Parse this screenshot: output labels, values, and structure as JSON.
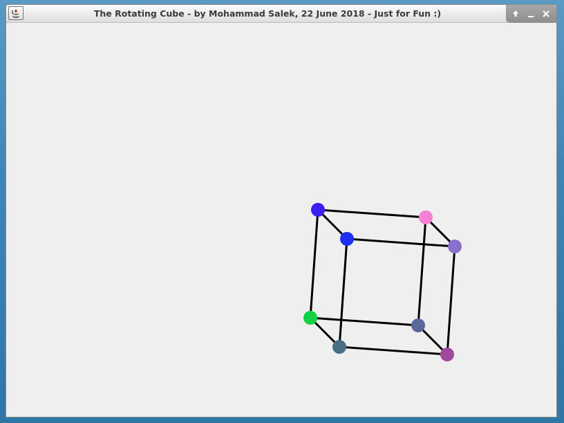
{
  "window": {
    "title": "The Rotating Cube - by Mohammad Salek, 22 June 2018 - Just for Fun :)",
    "icon": "java-app-icon",
    "controls": {
      "maximize": "maximize-icon",
      "minimize": "minimize-icon",
      "close": "close-icon"
    }
  },
  "scene": {
    "edge_color": "#000000",
    "vertices": [
      {
        "id": "v1",
        "color": "#3a1ff0"
      },
      {
        "id": "v2",
        "color": "#f47fd4"
      },
      {
        "id": "v3",
        "color": "#1f2ef3"
      },
      {
        "id": "v4",
        "color": "#8b6fcc"
      },
      {
        "id": "v5",
        "color": "#10d243"
      },
      {
        "id": "v6",
        "color": "#59689b"
      },
      {
        "id": "v7",
        "color": "#476e83"
      },
      {
        "id": "v8",
        "color": "#a0479e"
      }
    ],
    "edges": [
      [
        "v1",
        "v2"
      ],
      [
        "v1",
        "v3"
      ],
      [
        "v2",
        "v4"
      ],
      [
        "v3",
        "v4"
      ],
      [
        "v5",
        "v6"
      ],
      [
        "v5",
        "v7"
      ],
      [
        "v6",
        "v8"
      ],
      [
        "v7",
        "v8"
      ],
      [
        "v1",
        "v5"
      ],
      [
        "v2",
        "v6"
      ],
      [
        "v3",
        "v7"
      ],
      [
        "v4",
        "v8"
      ]
    ]
  }
}
